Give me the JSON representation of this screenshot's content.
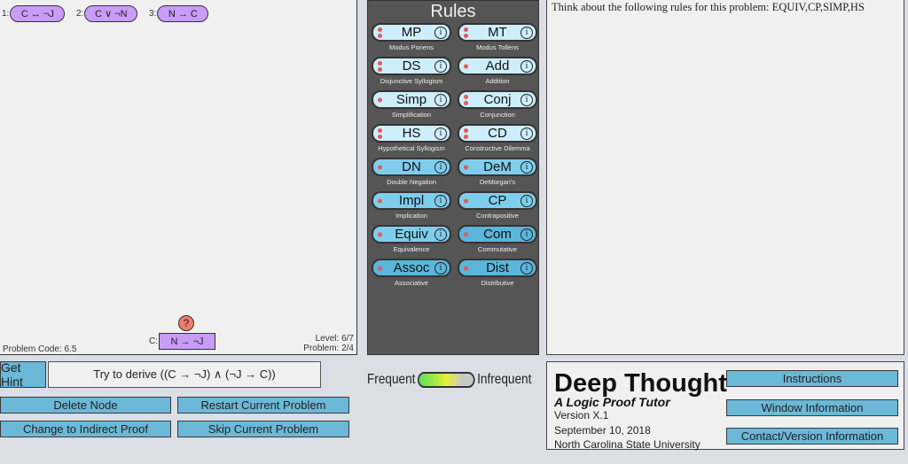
{
  "canvas": {
    "premises": [
      {
        "num": "1:",
        "formula": "C ↔ ¬J"
      },
      {
        "num": "2:",
        "formula": "C ∨ ¬N"
      },
      {
        "num": "3:",
        "formula": "N → C"
      }
    ],
    "conclusion": {
      "label": "C:",
      "formula": "N → ¬J",
      "help_glyph": "?"
    },
    "problem_code": "Problem Code: 6.5",
    "level": "Level: 6/7",
    "problem": "Problem: 2/4"
  },
  "rules": {
    "title": "Rules",
    "info_glyph": "i",
    "items": [
      {
        "abbr": "MP",
        "name": "Modus Ponens",
        "dots": 2,
        "color": "#cdeefa"
      },
      {
        "abbr": "MT",
        "name": "Modus Tollens",
        "dots": 2,
        "color": "#cdeefa"
      },
      {
        "abbr": "DS",
        "name": "Disjunctive Syllogism",
        "dots": 2,
        "color": "#cdeefa"
      },
      {
        "abbr": "Add",
        "name": "Addition",
        "dots": 1,
        "color": "#cdeefa"
      },
      {
        "abbr": "Simp",
        "name": "Simplification",
        "dots": 1,
        "color": "#cdeefa"
      },
      {
        "abbr": "Conj",
        "name": "Conjunction",
        "dots": 2,
        "color": "#cdeefa"
      },
      {
        "abbr": "HS",
        "name": "Hypothetical Syllogism",
        "dots": 2,
        "color": "#cdeefa"
      },
      {
        "abbr": "CD",
        "name": "Constructive Dilemma",
        "dots": 2,
        "color": "#cdeefa"
      },
      {
        "abbr": "DN",
        "name": "Double Negation",
        "dots": 1,
        "color": "#7fcdec"
      },
      {
        "abbr": "DeM",
        "name": "DeMorgan's",
        "dots": 1,
        "color": "#7fcdec"
      },
      {
        "abbr": "Impl",
        "name": "Implication",
        "dots": 1,
        "color": "#7fcdec"
      },
      {
        "abbr": "CP",
        "name": "Contrapositive",
        "dots": 1,
        "color": "#7fcdec"
      },
      {
        "abbr": "Equiv",
        "name": "Equivalence",
        "dots": 1,
        "color": "#7fcdec"
      },
      {
        "abbr": "Com",
        "name": "Commutative",
        "dots": 1,
        "color": "#5ab6dc"
      },
      {
        "abbr": "Assoc",
        "name": "Associative",
        "dots": 1,
        "color": "#5ab6dc"
      },
      {
        "abbr": "Dist",
        "name": "Distributive",
        "dots": 1,
        "color": "#5ab6dc"
      }
    ]
  },
  "hint_panel": {
    "text": "Think about the following rules for this problem: EQUIV,CP,SIMP,HS"
  },
  "controls": {
    "get_hint": "Get Hint",
    "goal": "Try to derive ((C → ¬J) ∧ (¬J → C))",
    "delete_node": "Delete Node",
    "restart": "Restart Current Problem",
    "indirect": "Change to Indirect Proof",
    "skip": "Skip Current Problem"
  },
  "frequency": {
    "left_label": "Frequent",
    "right_label": "Infrequent"
  },
  "about": {
    "title": "Deep Thought",
    "subtitle": "A Logic Proof Tutor",
    "version": "Version X.1",
    "date": "September 10, 2018",
    "org": "North Carolina State University",
    "instructions": "Instructions",
    "window_info": "Window Information",
    "contact": "Contact/Version Information"
  }
}
